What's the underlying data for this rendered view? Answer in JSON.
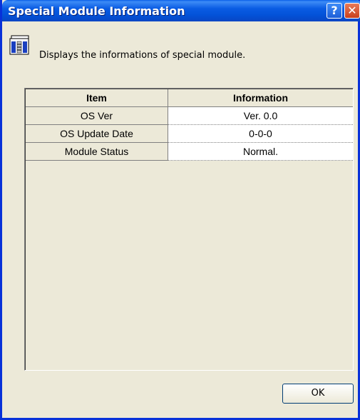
{
  "window": {
    "title": "Special Module Information",
    "help_glyph": "?",
    "close_glyph": "✕"
  },
  "header": {
    "icon": "module-rack-icon",
    "description": "Displays the informations of special module."
  },
  "table": {
    "columns": [
      "Item",
      "Information"
    ],
    "rows": [
      {
        "item": "OS Ver",
        "info": "Ver.  0.0"
      },
      {
        "item": "OS Update Date",
        "info": "0-0-0"
      },
      {
        "item": "Module Status",
        "info": "Normal."
      }
    ]
  },
  "footer": {
    "ok_label": "OK"
  }
}
